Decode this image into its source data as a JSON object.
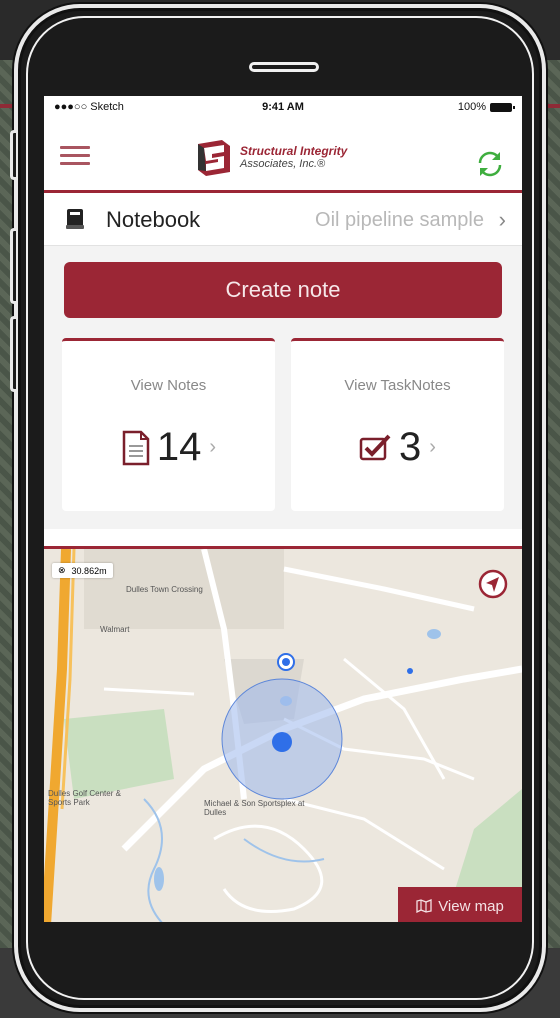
{
  "status_bar": {
    "carrier": "●●●○○ Sketch",
    "time": "9:41 AM",
    "battery": "100%"
  },
  "header": {
    "logo_line1": "Structural Integrity",
    "logo_line2": "Associates, Inc.®",
    "menu_icon": "hamburger-icon",
    "sync_icon": "sync-icon"
  },
  "notebook": {
    "label": "Notebook",
    "value": "Oil pipeline sample",
    "chevron": "›"
  },
  "actions": {
    "create_note": "Create note"
  },
  "cards": [
    {
      "title": "View Notes",
      "count": "14",
      "icon": "document-icon"
    },
    {
      "title": "View TaskNotes",
      "count": "3",
      "icon": "checkbox-icon"
    }
  ],
  "map": {
    "scale": "30.862m",
    "view_map_label": "View map",
    "places": [
      "Dulles Town Crossing",
      "Walmart",
      "Dulles Golf Center & Sports Park",
      "Michael & Son Sportsplex at Dulles"
    ]
  },
  "colors": {
    "brand": "#9b2635",
    "sync": "#3fae3f",
    "map_land": "#ece7de",
    "location": "#2f6fe8"
  }
}
